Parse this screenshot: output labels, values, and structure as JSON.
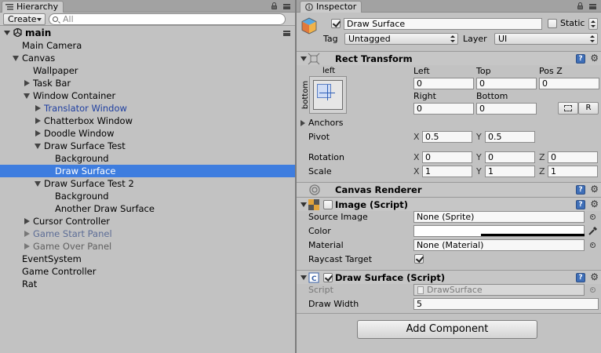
{
  "colors": {
    "selection": "#3e7ddf",
    "prefab_text": "#1f3fa0",
    "panel_bg": "#c2c2c2"
  },
  "hierarchy": {
    "tab_label": "Hierarchy",
    "create_label": "Create",
    "search_placeholder": "All",
    "scene_name": "main",
    "rows": [
      {
        "label": "Main Camera",
        "depth": 0,
        "fold": "none",
        "style": "normal"
      },
      {
        "label": "Canvas",
        "depth": 0,
        "fold": "open",
        "style": "normal"
      },
      {
        "label": "Wallpaper",
        "depth": 1,
        "fold": "none",
        "style": "normal"
      },
      {
        "label": "Task Bar",
        "depth": 1,
        "fold": "closed",
        "style": "normal"
      },
      {
        "label": "Window Container",
        "depth": 1,
        "fold": "open",
        "style": "normal"
      },
      {
        "label": "Translator Window",
        "depth": 2,
        "fold": "closed",
        "style": "prefab"
      },
      {
        "label": "Chatterbox Window",
        "depth": 2,
        "fold": "closed",
        "style": "normal"
      },
      {
        "label": "Doodle Window",
        "depth": 2,
        "fold": "closed",
        "style": "normal"
      },
      {
        "label": "Draw Surface Test",
        "depth": 2,
        "fold": "open",
        "style": "normal"
      },
      {
        "label": "Background",
        "depth": 3,
        "fold": "none",
        "style": "normal"
      },
      {
        "label": "Draw Surface",
        "depth": 3,
        "fold": "none",
        "style": "selected"
      },
      {
        "label": "Draw Surface Test 2",
        "depth": 2,
        "fold": "open",
        "style": "normal"
      },
      {
        "label": "Background",
        "depth": 3,
        "fold": "none",
        "style": "normal"
      },
      {
        "label": "Another Draw Surface",
        "depth": 3,
        "fold": "none",
        "style": "normal"
      },
      {
        "label": "Cursor Controller",
        "depth": 1,
        "fold": "closed",
        "style": "normal"
      },
      {
        "label": "Game Start Panel",
        "depth": 1,
        "fold": "closed",
        "style": "prefab-disabled"
      },
      {
        "label": "Game Over Panel",
        "depth": 1,
        "fold": "closed",
        "style": "disabled"
      },
      {
        "label": "EventSystem",
        "depth": 0,
        "fold": "none",
        "style": "normal"
      },
      {
        "label": "Game Controller",
        "depth": 0,
        "fold": "none",
        "style": "normal"
      },
      {
        "label": "Rat",
        "depth": 0,
        "fold": "none",
        "style": "normal"
      }
    ]
  },
  "inspector": {
    "tab_label": "Inspector",
    "object_name": "Draw Surface",
    "static_label": "Static",
    "tag_label": "Tag",
    "tag_value": "Untagged",
    "layer_label": "Layer",
    "layer_value": "UI",
    "rect_transform": {
      "title": "Rect Transform",
      "h_anchor": "left",
      "v_anchor": "bottom",
      "left_label": "Left",
      "left_value": "0",
      "top_label": "Top",
      "top_value": "0",
      "posz_label": "Pos Z",
      "posz_value": "0",
      "right_label": "Right",
      "right_value": "0",
      "bottom_label": "Bottom",
      "bottom_value": "0",
      "raw_btn_label": "R",
      "anchors_label": "Anchors",
      "pivot_label": "Pivot",
      "pivot_x": "0.5",
      "pivot_y": "0.5",
      "rotation_label": "Rotation",
      "rot_x": "0",
      "rot_y": "0",
      "rot_z": "0",
      "scale_label": "Scale",
      "scale_x": "1",
      "scale_y": "1",
      "scale_z": "1",
      "axis_x": "X",
      "axis_y": "Y",
      "axis_z": "Z"
    },
    "canvas_renderer": {
      "title": "Canvas Renderer"
    },
    "image": {
      "title": "Image (Script)",
      "source_label": "Source Image",
      "source_value": "None (Sprite)",
      "color_label": "Color",
      "material_label": "Material",
      "material_value": "None (Material)",
      "raycast_label": "Raycast Target"
    },
    "draw_surface": {
      "title": "Draw Surface (Script)",
      "script_label": "Script",
      "script_value": "DrawSurface",
      "width_label": "Draw Width",
      "width_value": "5"
    },
    "add_component": "Add Component"
  }
}
